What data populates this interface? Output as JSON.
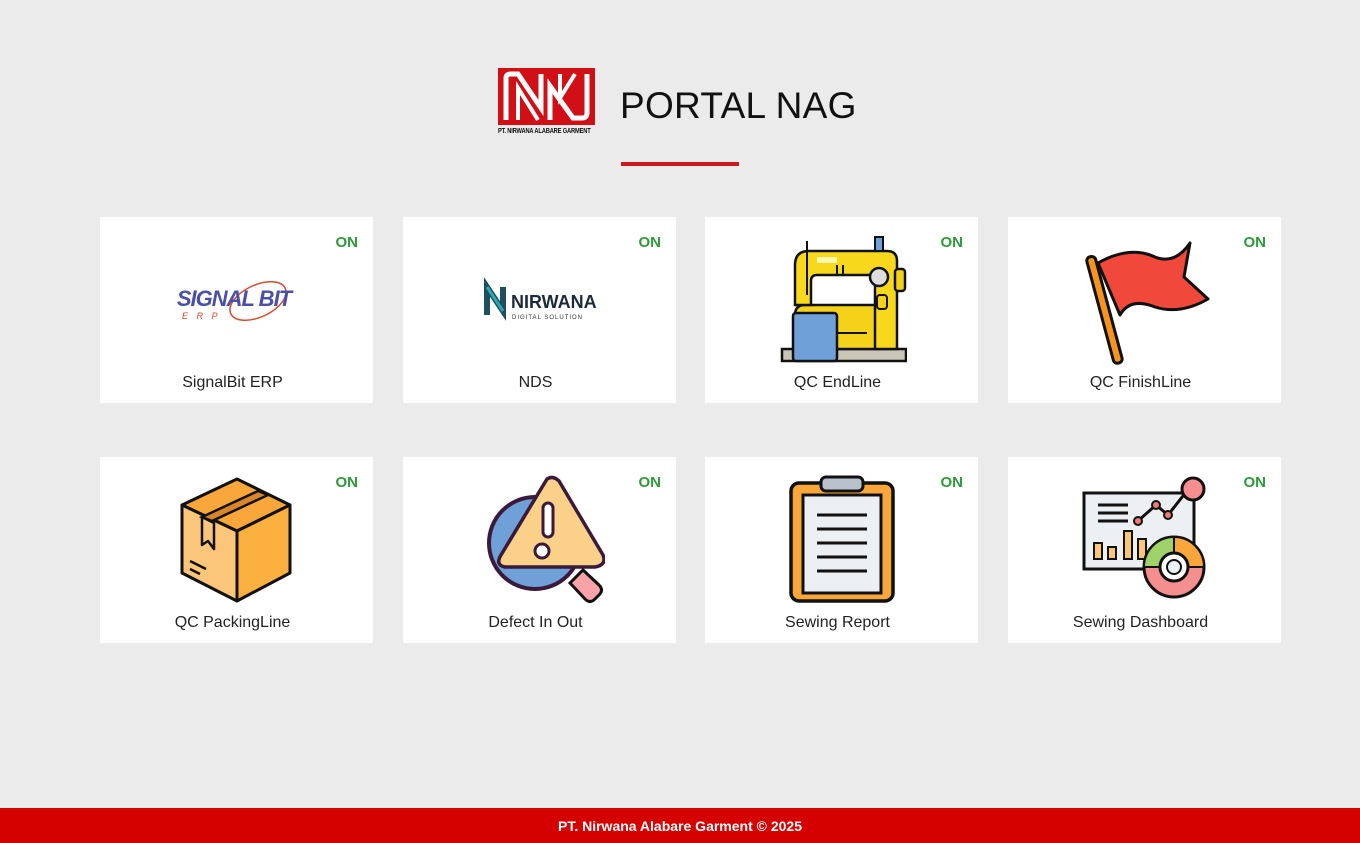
{
  "header": {
    "logo_subtext": "PT. NIRWANA ALABARE GARMENT",
    "title": "PORTAL NAG"
  },
  "cards": [
    {
      "label": "SignalBit ERP",
      "status": "ON",
      "icon": "signalbit-logo"
    },
    {
      "label": "NDS",
      "status": "ON",
      "icon": "nirwana-digital-solution-logo"
    },
    {
      "label": "QC EndLine",
      "status": "ON",
      "icon": "sewing-machine-icon"
    },
    {
      "label": "QC FinishLine",
      "status": "ON",
      "icon": "flag-icon"
    },
    {
      "label": "QC PackingLine",
      "status": "ON",
      "icon": "box-icon"
    },
    {
      "label": "Defect In Out",
      "status": "ON",
      "icon": "warning-search-icon"
    },
    {
      "label": "Sewing Report",
      "status": "ON",
      "icon": "clipboard-icon"
    },
    {
      "label": "Sewing Dashboard",
      "status": "ON",
      "icon": "dashboard-chart-icon"
    }
  ],
  "logos": {
    "signalbit": {
      "main": "SIGNAL BIT",
      "sub": "E R P"
    },
    "nirwana": {
      "main": "NIRWANA",
      "sub": "DIGITAL SOLUTION"
    }
  },
  "footer": {
    "text": "PT. Nirwana Alabare Garment © 2025"
  },
  "colors": {
    "brand_red": "#d50000",
    "status_on": "#2e9a3a",
    "background": "#ebebeb"
  }
}
